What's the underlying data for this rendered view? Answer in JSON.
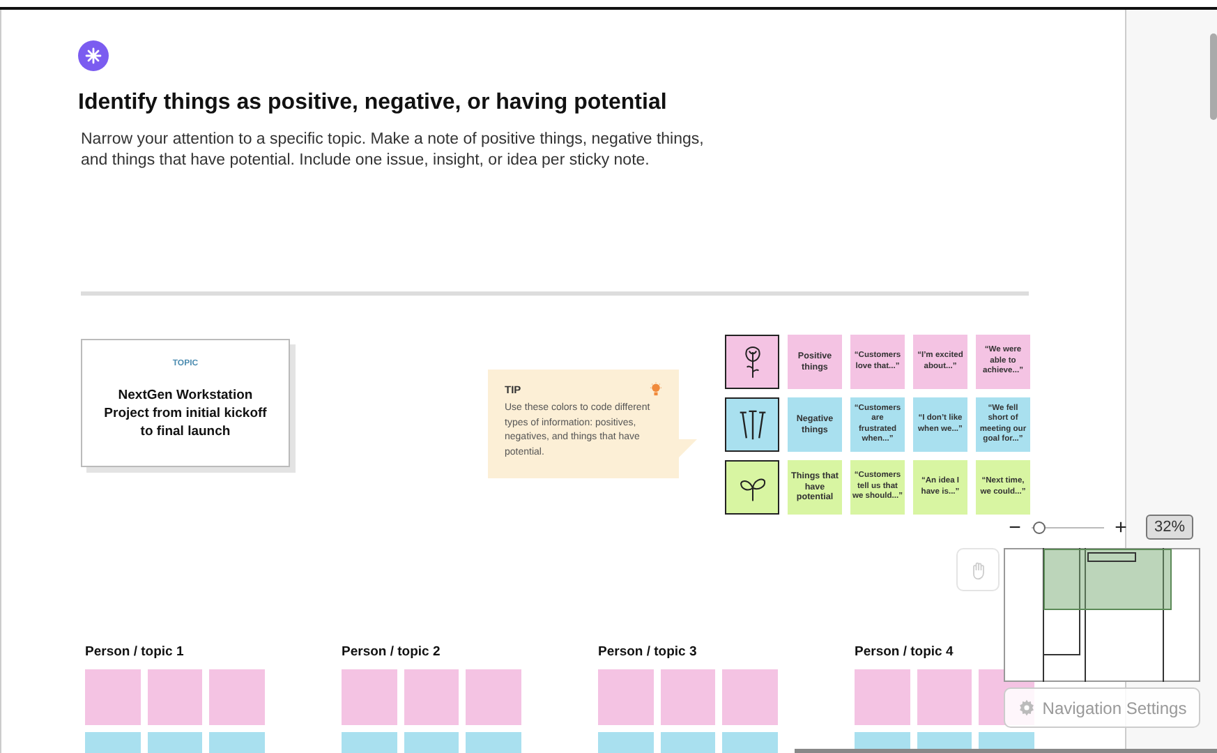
{
  "header": {
    "title": "Identify things as positive, negative, or having potential",
    "description": "Narrow your attention to a specific topic. Make a note of positive things, negative things, and things that have potential. Include one issue, insight, or idea per sticky note."
  },
  "topic_card": {
    "label": "TOPIC",
    "text": "NextGen Workstation Project from initial kickoff to final launch"
  },
  "tip": {
    "title": "TIP",
    "text": "Use these colors to code different types of information: positives, negatives, and things that have potential."
  },
  "legend": [
    {
      "kind": "positive",
      "color": "#f4c3e3",
      "cells": [
        "Positive things",
        "“Customers love that...”",
        "“I’m excited about...”",
        "“We were able to achieve...”"
      ]
    },
    {
      "kind": "negative",
      "color": "#a9e0ef",
      "cells": [
        "Negative things",
        "“Customers are frustrated when...”",
        "“I don’t like when we...”",
        "“We fell short of meeting our goal for...”"
      ]
    },
    {
      "kind": "potential",
      "color": "#d8f5a2",
      "cells": [
        "Things that have potential",
        "“Customers tell us that we should...”",
        "“An idea I have is...”",
        "“Next time, we could...”"
      ]
    }
  ],
  "person_topics": [
    {
      "label": "Person / topic 1",
      "rows": [
        {
          "color": "#f4c3e3"
        },
        {
          "color": "#a9e0ef"
        }
      ]
    },
    {
      "label": "Person / topic 2",
      "rows": [
        {
          "color": "#f4c3e3"
        },
        {
          "color": "#a9e0ef"
        }
      ]
    },
    {
      "label": "Person / topic 3",
      "rows": [
        {
          "color": "#f4c3e3"
        },
        {
          "color": "#a9e0ef"
        }
      ]
    },
    {
      "label": "Person / topic 4",
      "rows": [
        {
          "color": "#f4c3e3"
        },
        {
          "color": "#a9e0ef"
        }
      ]
    }
  ],
  "zoom": {
    "minus": "−",
    "plus": "+",
    "level": 0.12,
    "reading": "32%"
  },
  "navigation": {
    "button": "Navigation Settings"
  }
}
